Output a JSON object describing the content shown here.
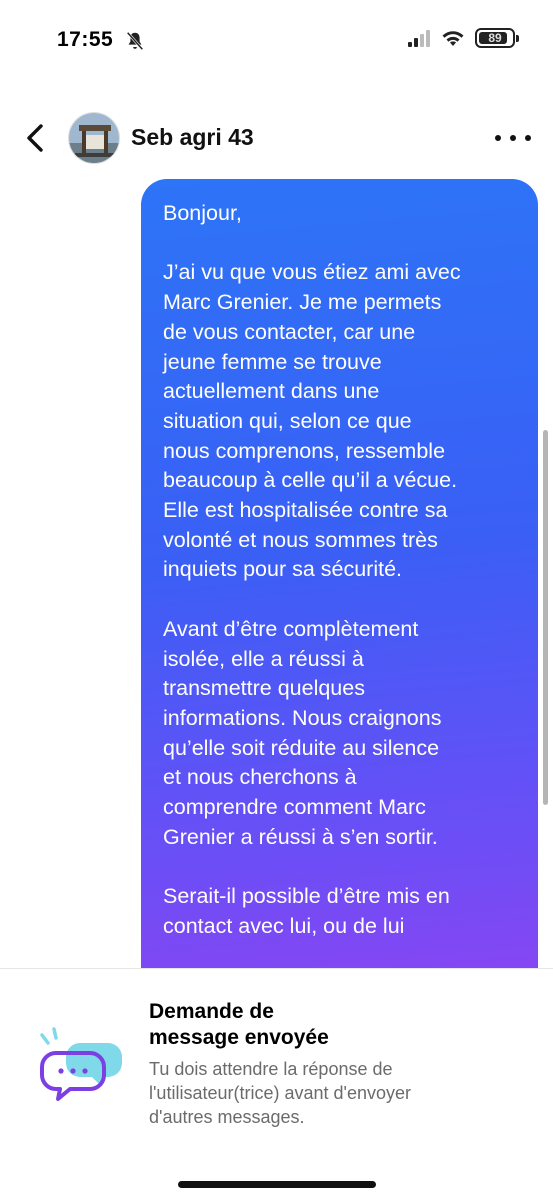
{
  "status_bar": {
    "time": "17:55",
    "battery": "89",
    "battery_level": 0.89,
    "icons": [
      "bell-muted-icon",
      "signal-icon",
      "wifi-icon",
      "battery-icon"
    ]
  },
  "header": {
    "contact_name": "Seb agri 43",
    "icons": [
      "back-chevron-icon",
      "more-dots-icon"
    ]
  },
  "message": {
    "paragraphs": [
      "Bonjour,",
      "J’ai vu que vous étiez ami avec\nMarc Grenier. Je me permets\nde vous contacter, car une\njeune femme se trouve\nactuellement dans une\nsituation qui, selon ce que\nnous comprenons, ressemble\nbeaucoup à celle qu’il a vécue.\nElle est hospitalisée contre sa\nvolonté et nous sommes très\ninquiets pour sa sécurité.",
      "Avant d’être complètement\nisolée, elle a réussi à\ntransmettre quelques\ninformations. Nous craignons\nqu’elle soit réduite au silence\net nous cherchons à\ncomprendre comment Marc\nGrenier a réussi à s’en sortir.",
      "Serait-il possible d’être mis en\ncontact avec lui, ou de lui"
    ],
    "gradient": [
      "#2d74f7",
      "#8a45f2"
    ]
  },
  "notice": {
    "title": "Demande de\nmessage envoyée",
    "description": "Tu dois attendre la réponse de\nl'utilisateur(trice) avant d'envoyer\nd'autres messages.",
    "icon": "message-request-sent-icon"
  }
}
